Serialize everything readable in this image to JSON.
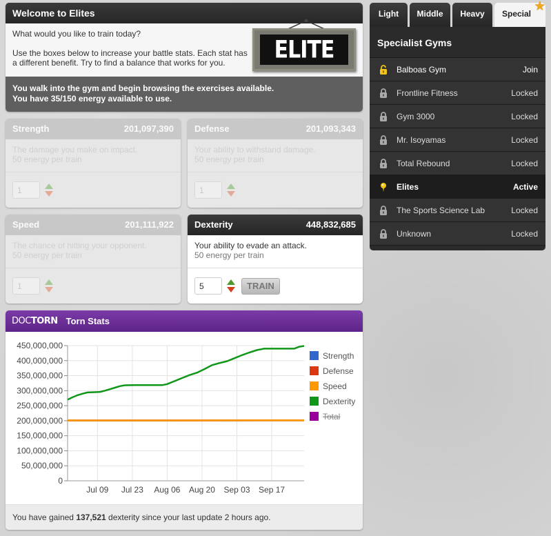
{
  "welcome": {
    "title": "Welcome to Elites",
    "question": "What would you like to train today?",
    "instructions": "Use the boxes below to increase your battle stats. Each stat has a different benefit. Try to find a balance that works for you.",
    "status_line1": "You walk into the gym and begin browsing the exercises available.",
    "status_line2": "You have 35/150 energy available to use.",
    "sign_text": "ELITE"
  },
  "stats": {
    "strength": {
      "name": "Strength",
      "value": "201,097,390",
      "description": "The damage you make on impact.",
      "energy": "50 energy per train",
      "quantity": "1"
    },
    "defense": {
      "name": "Defense",
      "value": "201,093,343",
      "description": "Your ability to withstand damage.",
      "energy": "50 energy per train",
      "quantity": "1"
    },
    "speed": {
      "name": "Speed",
      "value": "201,111,922",
      "description": "The chance of hitting your opponent.",
      "energy": "50 energy per train",
      "quantity": "1"
    },
    "dexterity": {
      "name": "Dexterity",
      "value": "448,832,685",
      "description": "Your ability to evade an attack.",
      "energy": "50 energy per train",
      "quantity": "5",
      "train_label": "TRAIN"
    }
  },
  "tornstats": {
    "brand_light": "DOC",
    "brand_bold": "TORN",
    "title": "Torn Stats",
    "footer_prefix": "You have gained ",
    "footer_amount": "137,521",
    "footer_suffix": " dexterity since your last update 2 hours ago."
  },
  "chart_data": {
    "type": "line",
    "ylim": [
      0,
      450000000
    ],
    "yticks": [
      0,
      50000000,
      100000000,
      150000000,
      200000000,
      250000000,
      300000000,
      350000000,
      400000000,
      450000000
    ],
    "ytick_labels": [
      "0",
      "50,000,000",
      "100,000,000",
      "150,000,000",
      "200,000,000",
      "250,000,000",
      "300,000,000",
      "350,000,000",
      "400,000,000",
      "450,000,000"
    ],
    "xlim": [
      "2024-06-27",
      "2024-09-30"
    ],
    "xticks": [
      "2024-07-09",
      "2024-07-23",
      "2024-08-06",
      "2024-08-20",
      "2024-09-03",
      "2024-09-17"
    ],
    "xtick_labels": [
      "Jul 09",
      "Jul 23",
      "Aug 06",
      "Aug 20",
      "Sep 03",
      "Sep 17"
    ],
    "grid": true,
    "legend_position": "right",
    "series": [
      {
        "name": "Strength",
        "color": "#3366cc",
        "hidden": false,
        "x": [
          "2024-06-27",
          "2024-09-30"
        ],
        "y": [
          201000000,
          201097390
        ]
      },
      {
        "name": "Defense",
        "color": "#dc3912",
        "hidden": false,
        "x": [
          "2024-06-27",
          "2024-09-30"
        ],
        "y": [
          201000000,
          201093343
        ]
      },
      {
        "name": "Speed",
        "color": "#ff9900",
        "hidden": false,
        "x": [
          "2024-06-27",
          "2024-09-30"
        ],
        "y": [
          201000000,
          201111922
        ]
      },
      {
        "name": "Dexterity",
        "color": "#109618",
        "hidden": false,
        "x": [
          "2024-06-27",
          "2024-06-29",
          "2024-07-01",
          "2024-07-03",
          "2024-07-05",
          "2024-07-08",
          "2024-07-10",
          "2024-07-12",
          "2024-07-14",
          "2024-07-16",
          "2024-07-18",
          "2024-07-20",
          "2024-07-24",
          "2024-07-28",
          "2024-08-01",
          "2024-08-04",
          "2024-08-06",
          "2024-08-09",
          "2024-08-12",
          "2024-08-15",
          "2024-08-18",
          "2024-08-21",
          "2024-08-24",
          "2024-08-27",
          "2024-08-30",
          "2024-09-02",
          "2024-09-05",
          "2024-09-08",
          "2024-09-11",
          "2024-09-14",
          "2024-09-18",
          "2024-09-22",
          "2024-09-26",
          "2024-09-28",
          "2024-09-30"
        ],
        "y": [
          270000000,
          278000000,
          285000000,
          290000000,
          294000000,
          295000000,
          296000000,
          300000000,
          305000000,
          310000000,
          315000000,
          318000000,
          318500000,
          318500000,
          318500000,
          318500000,
          322000000,
          332000000,
          342000000,
          352000000,
          360000000,
          372000000,
          385000000,
          392000000,
          398000000,
          408000000,
          418000000,
          427000000,
          435000000,
          440000000,
          440000000,
          440000000,
          440000000,
          446000000,
          448832685
        ]
      },
      {
        "name": "Total",
        "color": "#990099",
        "hidden": true,
        "x": [],
        "y": []
      }
    ]
  },
  "sidebar": {
    "tabs": [
      {
        "label": "Light",
        "active": false
      },
      {
        "label": "Middle",
        "active": false
      },
      {
        "label": "Heavy",
        "active": false
      },
      {
        "label": "Special",
        "active": true
      }
    ],
    "list_title": "Specialist Gyms",
    "gyms": [
      {
        "name": "Balboas Gym",
        "status": "Join",
        "icon": "unlock-icon"
      },
      {
        "name": "Frontline Fitness",
        "status": "Locked",
        "icon": "lock-icon"
      },
      {
        "name": "Gym 3000",
        "status": "Locked",
        "icon": "lock-icon"
      },
      {
        "name": "Mr. Isoyamas",
        "status": "Locked",
        "icon": "lock-icon"
      },
      {
        "name": "Total Rebound",
        "status": "Locked",
        "icon": "lock-icon"
      },
      {
        "name": "Elites",
        "status": "Active",
        "icon": "location-pin-icon"
      },
      {
        "name": "The Sports Science Lab",
        "status": "Locked",
        "icon": "lock-icon"
      },
      {
        "name": "Unknown",
        "status": "Locked",
        "icon": "lock-icon"
      }
    ]
  }
}
